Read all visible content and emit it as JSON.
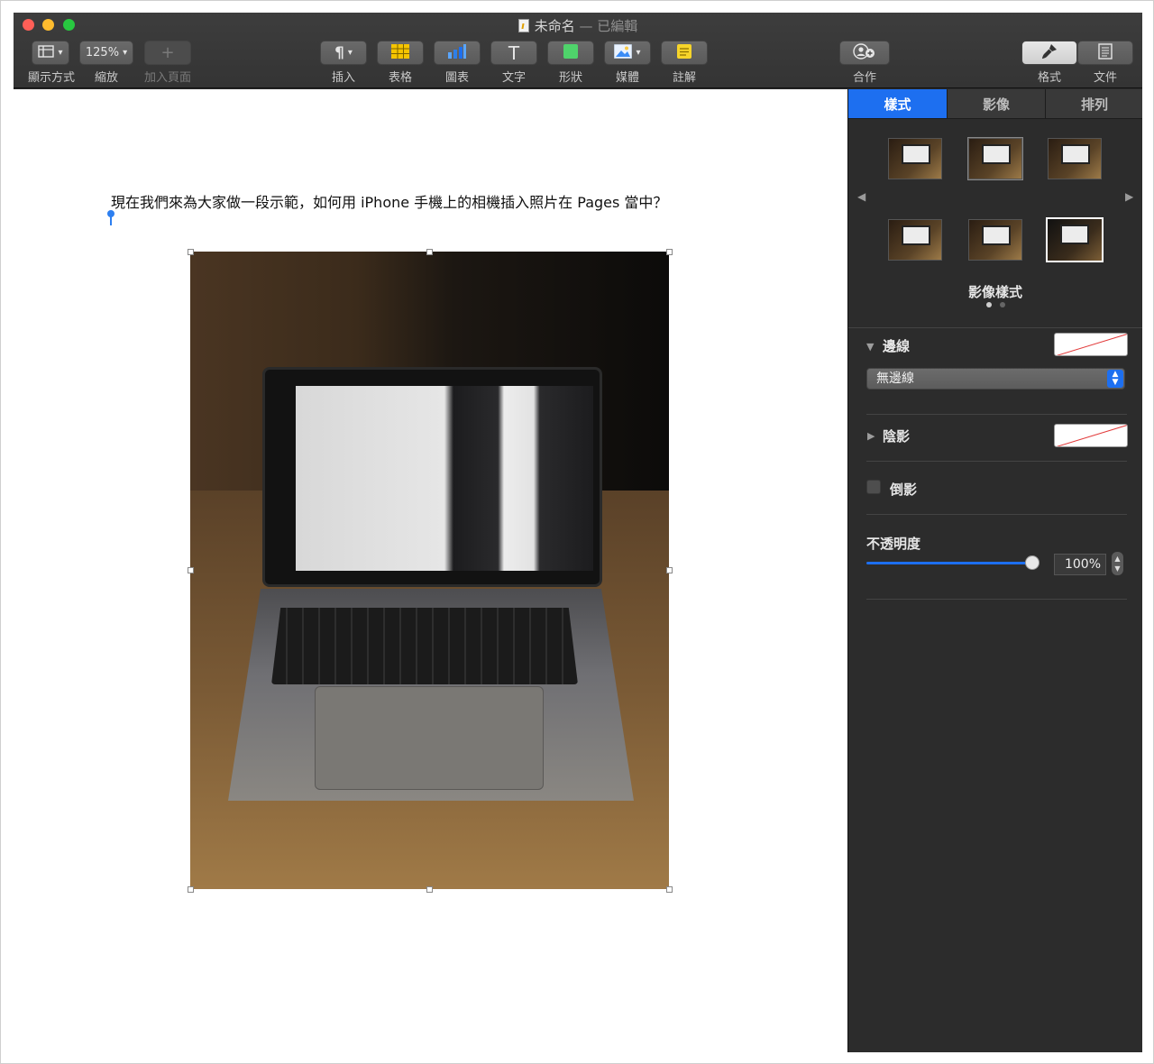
{
  "window": {
    "title": "未命名",
    "status": "已編輯",
    "title_sep": "—"
  },
  "toolbar": {
    "view": {
      "label": "顯示方式",
      "icon": "sidebar-layout-icon"
    },
    "zoom": {
      "label": "縮放",
      "value": "125%"
    },
    "add_page": {
      "label": "加入頁面",
      "icon": "plus-icon"
    },
    "insert": {
      "label": "插入",
      "icon": "pilcrow-icon",
      "glyph": "¶"
    },
    "table": {
      "label": "表格",
      "icon": "table-icon"
    },
    "chart": {
      "label": "圖表",
      "icon": "bar-chart-icon"
    },
    "text": {
      "label": "文字",
      "icon": "text-t-icon",
      "glyph": "T"
    },
    "shape": {
      "label": "形狀",
      "icon": "square-shape-icon"
    },
    "media": {
      "label": "媒體",
      "icon": "photo-icon"
    },
    "comment": {
      "label": "註解",
      "icon": "note-icon"
    },
    "collaborate": {
      "label": "合作",
      "icon": "collaborate-person-icon"
    },
    "format": {
      "label": "格式",
      "icon": "paintbrush-icon"
    },
    "document": {
      "label": "文件",
      "icon": "document-icon"
    }
  },
  "document": {
    "body_text": "現在我們來為大家做一段示範，如何用 iPhone 手機上的相機插入照片在 Pages 當中？"
  },
  "sidebar": {
    "tabs": [
      {
        "label": "樣式"
      },
      {
        "label": "影像"
      },
      {
        "label": "排列"
      }
    ],
    "image_styles_title": "影像樣式",
    "border": {
      "label": "邊線",
      "select_value": "無邊線"
    },
    "shadow": {
      "label": "陰影"
    },
    "reflection": {
      "label": "倒影",
      "checked": false
    },
    "opacity": {
      "label": "不透明度",
      "value": "100%",
      "level": 1.0
    }
  },
  "colors": {
    "accent": "#1d6ff0",
    "toolbar_bg": "#3d3d3d",
    "sidebar_bg": "#2c2c2c"
  }
}
